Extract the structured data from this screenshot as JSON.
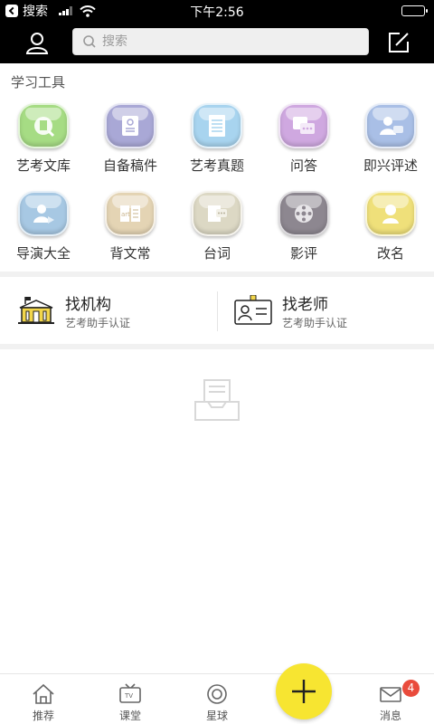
{
  "status_bar": {
    "back_label": "搜索",
    "time": "下午2:56"
  },
  "header": {
    "search_placeholder": "搜索"
  },
  "tools": {
    "title": "学习工具",
    "items": [
      {
        "label": "艺考文库",
        "icon": "library-icon",
        "color": "#a6dc84"
      },
      {
        "label": "自备稿件",
        "icon": "notebook-icon",
        "color": "#a9a8d6"
      },
      {
        "label": "艺考真题",
        "icon": "document-icon",
        "color": "#a8d4ef"
      },
      {
        "label": "问答",
        "icon": "qa-icon",
        "color": "#cfa8e0"
      },
      {
        "label": "即兴评述",
        "icon": "speaker-icon",
        "color": "#a9bfe6"
      },
      {
        "label": "导演大全",
        "icon": "director-icon",
        "color": "#a7c8e3"
      },
      {
        "label": "背文常",
        "icon": "art-book-icon",
        "color": "#e4d4b4"
      },
      {
        "label": "台词",
        "icon": "script-icon",
        "color": "#dcd8c4"
      },
      {
        "label": "影评",
        "icon": "film-reel-icon",
        "color": "#8d8790"
      },
      {
        "label": "改名",
        "icon": "rename-icon",
        "color": "#efe07a"
      }
    ]
  },
  "cards": [
    {
      "title": "找机构",
      "subtitle": "艺考助手认证",
      "icon": "institution-icon"
    },
    {
      "title": "找老师",
      "subtitle": "艺考助手认证",
      "icon": "teacher-badge-icon"
    }
  ],
  "bottom_nav": {
    "items": [
      {
        "label": "推荐",
        "icon": "home-icon"
      },
      {
        "label": "课堂",
        "icon": "tv-icon"
      },
      {
        "label": "星球",
        "icon": "planet-icon"
      },
      {
        "label": "消息",
        "icon": "mail-icon"
      }
    ],
    "fab_icon": "plus-icon",
    "fab_color": "#f7e531",
    "message_badge": "4"
  }
}
